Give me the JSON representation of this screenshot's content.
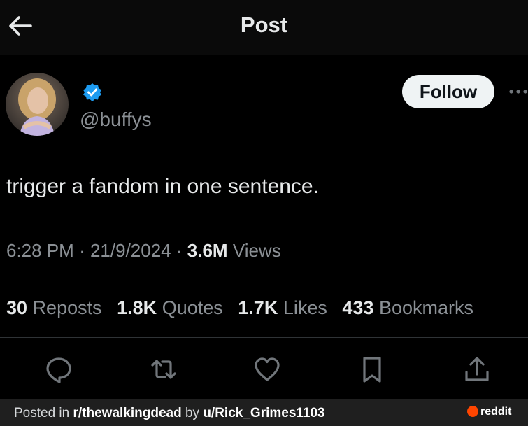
{
  "header": {
    "title": "Post"
  },
  "author": {
    "handle": "@buffys",
    "verified": true
  },
  "follow_label": "Follow",
  "tweet": {
    "text": "trigger a fandom in one sentence."
  },
  "meta": {
    "time": "6:28 PM",
    "date": "21/9/2024",
    "views_count": "3.6M",
    "views_label": "Views",
    "separator": "·"
  },
  "stats": [
    {
      "count": "30",
      "label": "Reposts"
    },
    {
      "count": "1.8K",
      "label": "Quotes"
    },
    {
      "count": "1.7K",
      "label": "Likes"
    },
    {
      "count": "433",
      "label": "Bookmarks"
    }
  ],
  "footer": {
    "prefix": "Posted in ",
    "subreddit": "r/thewalkingdead",
    "by": " by ",
    "user": "u/Rick_Grimes1103",
    "logo_text": "reddit"
  },
  "icons": [
    "back-arrow-icon",
    "verified-badge-icon",
    "more-icon",
    "reply-icon",
    "repost-icon",
    "like-icon",
    "bookmark-icon",
    "share-icon",
    "reddit-icon"
  ],
  "colors": {
    "background": "#000000",
    "verified": "#1d9bf0",
    "muted": "#8b9095",
    "reddit": "#ff4500"
  }
}
